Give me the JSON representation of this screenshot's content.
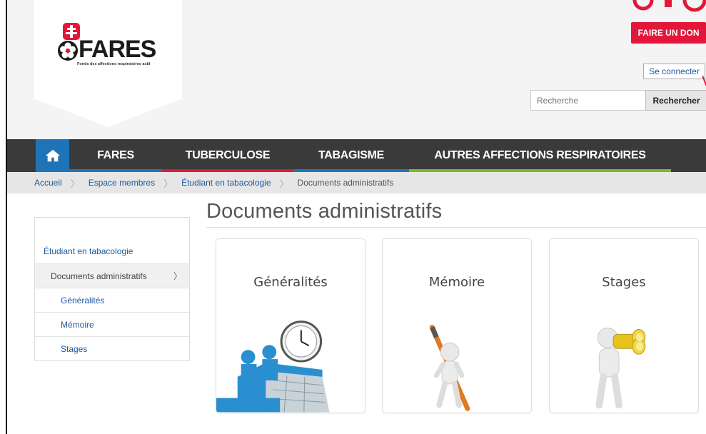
{
  "header": {
    "logo_text": "FARES",
    "logo_subtitle": "Fonds des affections respiratoires asbl",
    "donate_label": "FAIRE UN DON",
    "login_label": "Se connecter",
    "search_placeholder": "Recherche",
    "search_button_label": "Rechercher"
  },
  "nav": {
    "home_icon": "home-icon",
    "items": [
      {
        "label": "FARES",
        "color": "#1f74b8"
      },
      {
        "label": "TUBERCULOSE",
        "color": "#e3173a"
      },
      {
        "label": "TABAGISME",
        "color": "#1f74b8"
      },
      {
        "label": "AUTRES AFFECTIONS RESPIRATOIRES",
        "color": "#7ab829"
      }
    ]
  },
  "breadcrumb": {
    "items": [
      "Accueil",
      "Espace membres",
      "Étudiant en tabacologie"
    ],
    "current": "Documents administratifs"
  },
  "sidebar": {
    "parent": "Étudiant en tabacologie",
    "active": "Documents administratifs",
    "active_chevron": "〉",
    "children": [
      "Généralités",
      "Mémoire",
      "Stages"
    ]
  },
  "main": {
    "title": "Documents administratifs",
    "cards": [
      {
        "title": "Généralités",
        "image": "meeting-clock-illustration"
      },
      {
        "title": "Mémoire",
        "image": "person-with-pen-illustration"
      },
      {
        "title": "Stages",
        "image": "person-with-binoculars-illustration"
      }
    ]
  },
  "colors": {
    "accent_red": "#e3173a",
    "accent_blue": "#1f74b8",
    "accent_green": "#7ab829",
    "nav_bg": "#3a3a3a",
    "link": "#1e5aa0"
  }
}
